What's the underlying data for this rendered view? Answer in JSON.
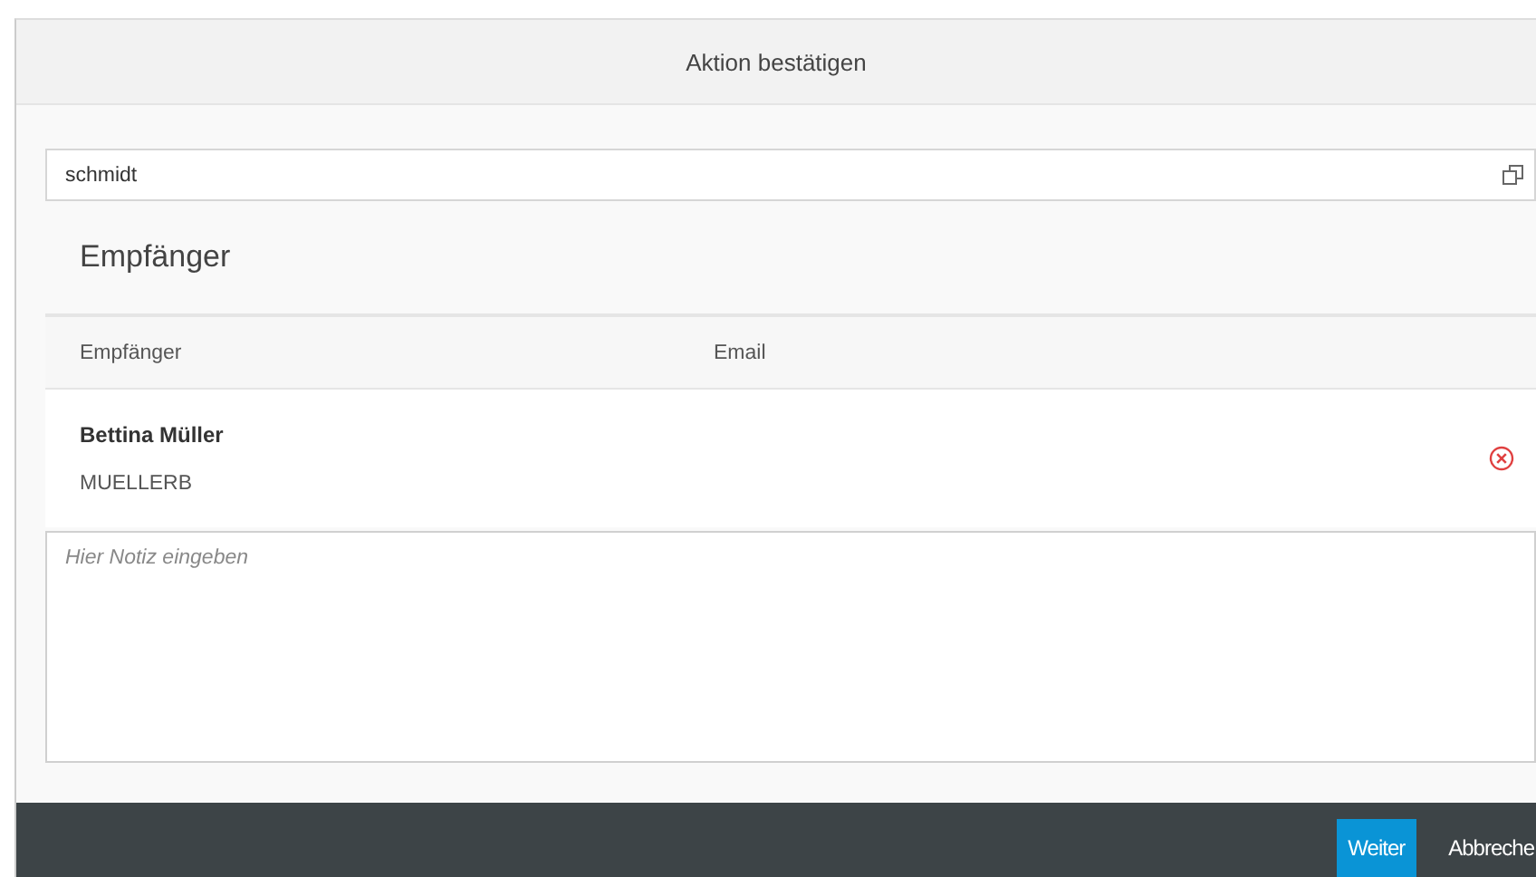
{
  "dialog": {
    "title": "Aktion bestätigen"
  },
  "search": {
    "value": "schmidt"
  },
  "section_title": "Empfänger",
  "table": {
    "columns": [
      "Empfänger",
      "Email"
    ],
    "rows": [
      {
        "name": "Bettina Müller",
        "id": "MUELLERB"
      }
    ]
  },
  "note": {
    "placeholder": "Hier Notiz eingeben"
  },
  "buttons": [
    {
      "label": "Weiter",
      "kind": "primary"
    },
    {
      "label": "Abbreche",
      "kind": "plain"
    }
  ]
}
